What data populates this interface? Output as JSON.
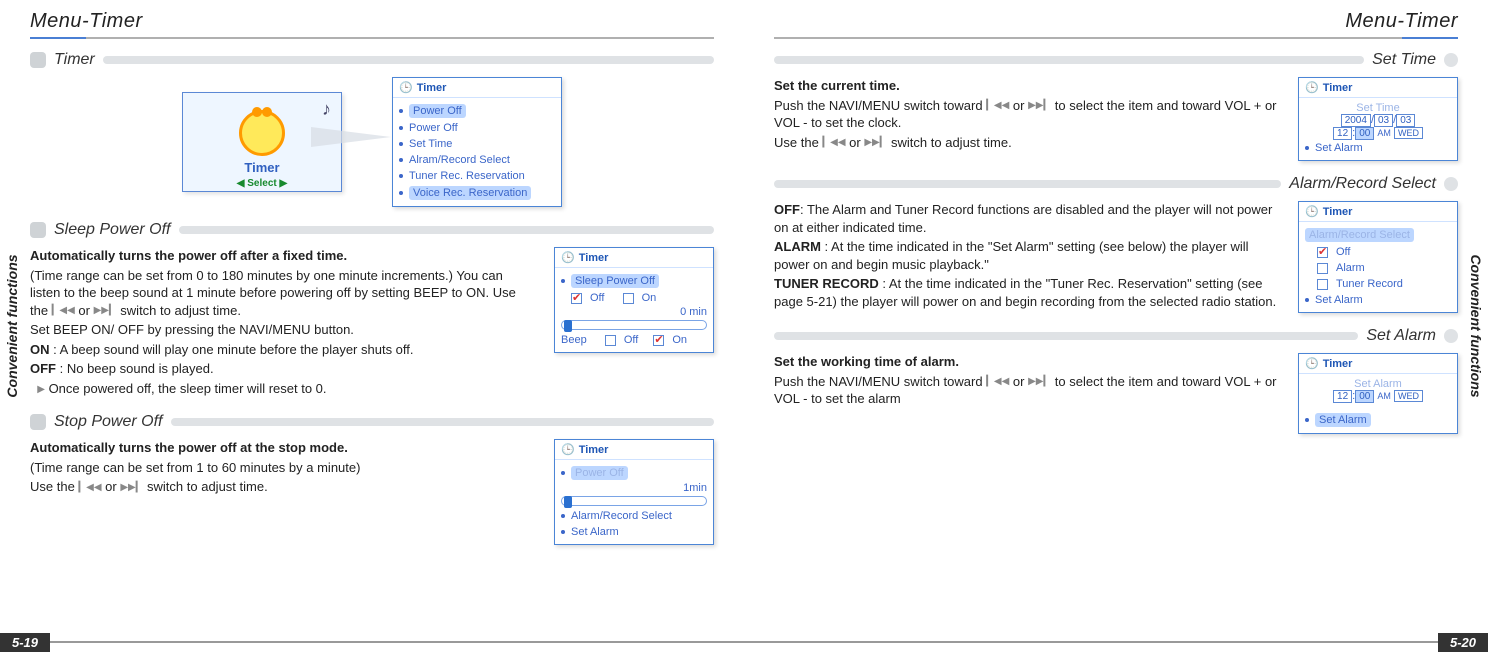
{
  "left": {
    "page_title": "Menu-Timer",
    "side_label": "Convenient functions",
    "page_number": "5-19",
    "timer": {
      "heading": "Timer",
      "big_label": "Timer",
      "big_footer": "◀ Select ▶",
      "note": "♪",
      "ss_header": "Timer",
      "ss_items": [
        "Power Off",
        "Power Off",
        "Set Time",
        "Alram/Record Select",
        "Tuner Rec. Reservation",
        "Voice Rec. Reservation"
      ]
    },
    "sleep": {
      "heading": "Sleep Power Off",
      "bold1": "Automatically turns the power off after a fixed time.",
      "p1": "(Time range can be set from 0 to 180 minutes by one minute increments.) You can listen to the beep sound at 1 minute before powering off by setting BEEP to ON. Use the",
      "p1b": "switch to adjust time.",
      "p2": "Set  BEEP ON/ OFF by pressing the NAVI/MENU button.",
      "on_label": "ON",
      "on_text": ": A beep sound will play one minute before the player shuts off.",
      "off_label": "OFF",
      "off_text": ": No beep sound is played.",
      "note": "Once powered off, the sleep timer will reset to 0.",
      "ss_header": "Timer",
      "ss_row1": "Sleep Power Off",
      "ss_off": "Off",
      "ss_on": "On",
      "ss_min": "0 min",
      "ss_beep": "Beep",
      "ss_boff": "Off",
      "ss_bon": "On"
    },
    "stop": {
      "heading": "Stop Power Off",
      "bold1": "Automatically turns the power off at the stop mode.",
      "p1": "(Time range can be set from 1 to 60 minutes by a minute)",
      "p2a": "Use the",
      "p2b": "switch to adjust time.",
      "ss_header": "Timer",
      "ss_row1": "Power Off",
      "ss_min": "1min",
      "ss_row2": "Alarm/Record Select",
      "ss_row3": "Set Alarm"
    }
  },
  "right": {
    "page_title": "Menu-Timer",
    "side_label": "Convenient functions",
    "page_number": "5-20",
    "settime": {
      "heading": "Set Time",
      "bold1": "Set the current time.",
      "p1a": "Push the NAVI/MENU switch toward",
      "p1b": "to select the item and toward VOL + or VOL - to set the clock.",
      "p2a": "Use the",
      "p2b": "switch to adjust time.",
      "ss_header": "Timer",
      "ss_row1": "Set Time",
      "ss_date1": "2004",
      "ss_date2": "03",
      "ss_date3": "03",
      "ss_time": "12",
      "ss_time2": "00",
      "ss_ampm": "AM",
      "ss_wday": "WED",
      "ss_row3": "Set Alarm"
    },
    "alarmrec": {
      "heading": "Alarm/Record Select",
      "off_label": "OFF",
      "off_text": ": The Alarm and Tuner Record functions are disabled and the player will not power on at either indicated time.",
      "alarm_label": "ALARM",
      "alarm_text": " : At the time indicated in the \"Set Alarm\" setting (see below) the player will power on and begin music playback.\"",
      "tuner_label": "TUNER RECORD",
      "tuner_text": " : At the time indicated in the \"Tuner Rec. Reservation\" setting (see page 5-21) the player will power on and begin recording from the selected radio station.",
      "ss_header": "Timer",
      "ss_row1": "Alarm/Record Select",
      "ss_opt1": "Off",
      "ss_opt2": "Alarm",
      "ss_opt3": "Tuner Record",
      "ss_row3": "Set Alarm"
    },
    "setalarm": {
      "heading": "Set Alarm",
      "bold1": "Set the working time of alarm.",
      "p1a": "Push the NAVI/MENU switch toward",
      "p1b": "to select the item and toward VOL + or VOL - to set the alarm",
      "ss_header": "Timer",
      "ss_row1": "Set Alarm",
      "ss_time": "12",
      "ss_time2": "00",
      "ss_ampm": "AM",
      "ss_wday": "WED",
      "ss_row3": "Set Alarm"
    }
  },
  "icons": {
    "prev": "▎◀◀",
    "next": "▶▶▎",
    "or": "or",
    "bullet_note": "▶"
  }
}
